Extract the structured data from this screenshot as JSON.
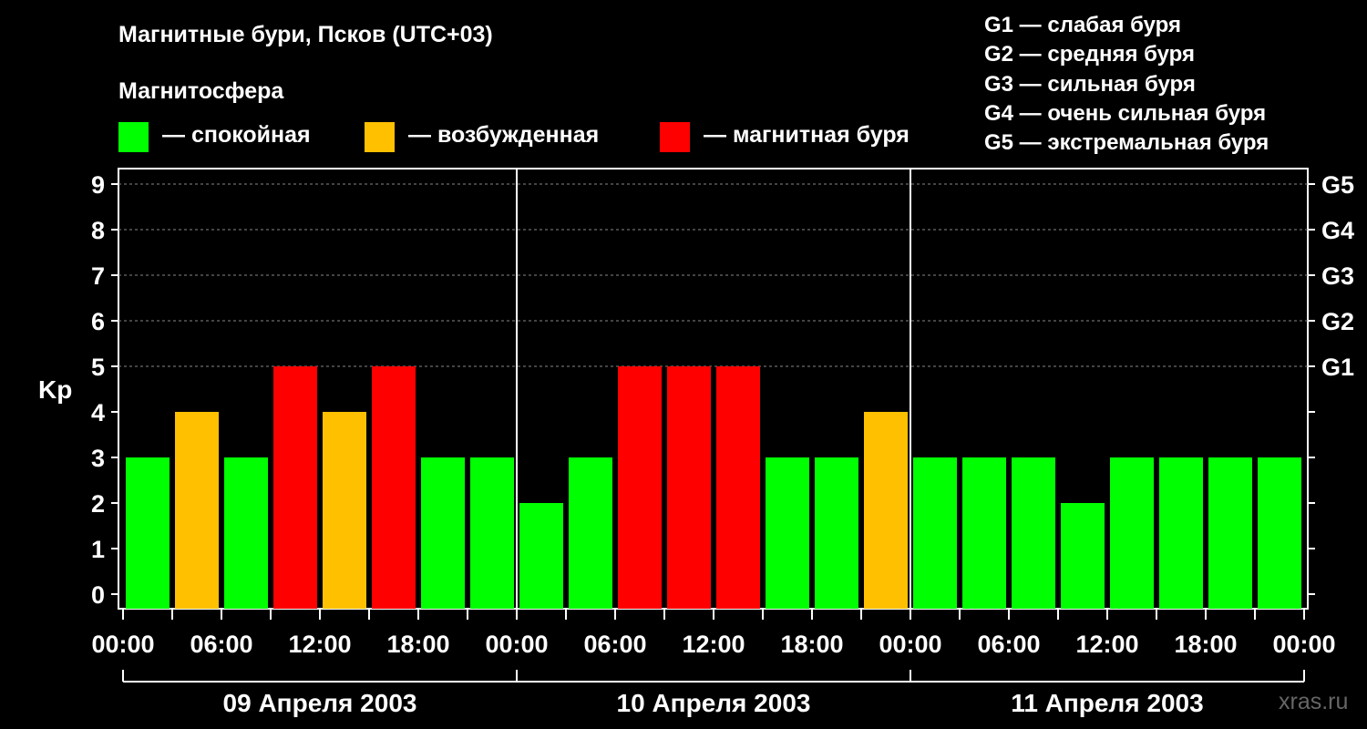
{
  "title": "Магнитные бури, Псков (UTC+03)",
  "legend": {
    "heading": "Магнитосфера",
    "items": [
      {
        "color": "#00ff00",
        "label": "— спокойная"
      },
      {
        "color": "#ffc000",
        "label": "— возбужденная"
      },
      {
        "color": "#ff0000",
        "label": "— магнитная буря"
      }
    ]
  },
  "storm_scale": [
    "G1 — слабая буря",
    "G2 — средняя буря",
    "G3 — сильная буря",
    "G4 — очень сильная буря",
    "G5 — экстремальная буря"
  ],
  "footer": "xras.ru",
  "chart_data": {
    "type": "bar",
    "ylabel": "Kp",
    "ylim": [
      0,
      9
    ],
    "y_ticks": [
      0,
      1,
      2,
      3,
      4,
      5,
      6,
      7,
      8,
      9
    ],
    "right_axis_labels": [
      {
        "kp": 5,
        "label": "G1"
      },
      {
        "kp": 6,
        "label": "G2"
      },
      {
        "kp": 7,
        "label": "G3"
      },
      {
        "kp": 8,
        "label": "G4"
      },
      {
        "kp": 9,
        "label": "G5"
      }
    ],
    "x_tick_labels": [
      "00:00",
      "06:00",
      "12:00",
      "18:00",
      "00:00",
      "06:00",
      "12:00",
      "18:00",
      "00:00",
      "06:00",
      "12:00",
      "18:00",
      "00:00"
    ],
    "days": [
      "09 Апреля 2003",
      "10 Апреля 2003",
      "11 Апреля 2003"
    ],
    "interval_hours": 3,
    "values": [
      3,
      4,
      3,
      5,
      4,
      5,
      3,
      3,
      2,
      3,
      5,
      5,
      5,
      3,
      3,
      4,
      3,
      3,
      3,
      2,
      3,
      3,
      3,
      3
    ],
    "colors": {
      "quiet": "#00ff00",
      "active": "#ffc000",
      "storm": "#ff0000"
    },
    "grid": true
  }
}
